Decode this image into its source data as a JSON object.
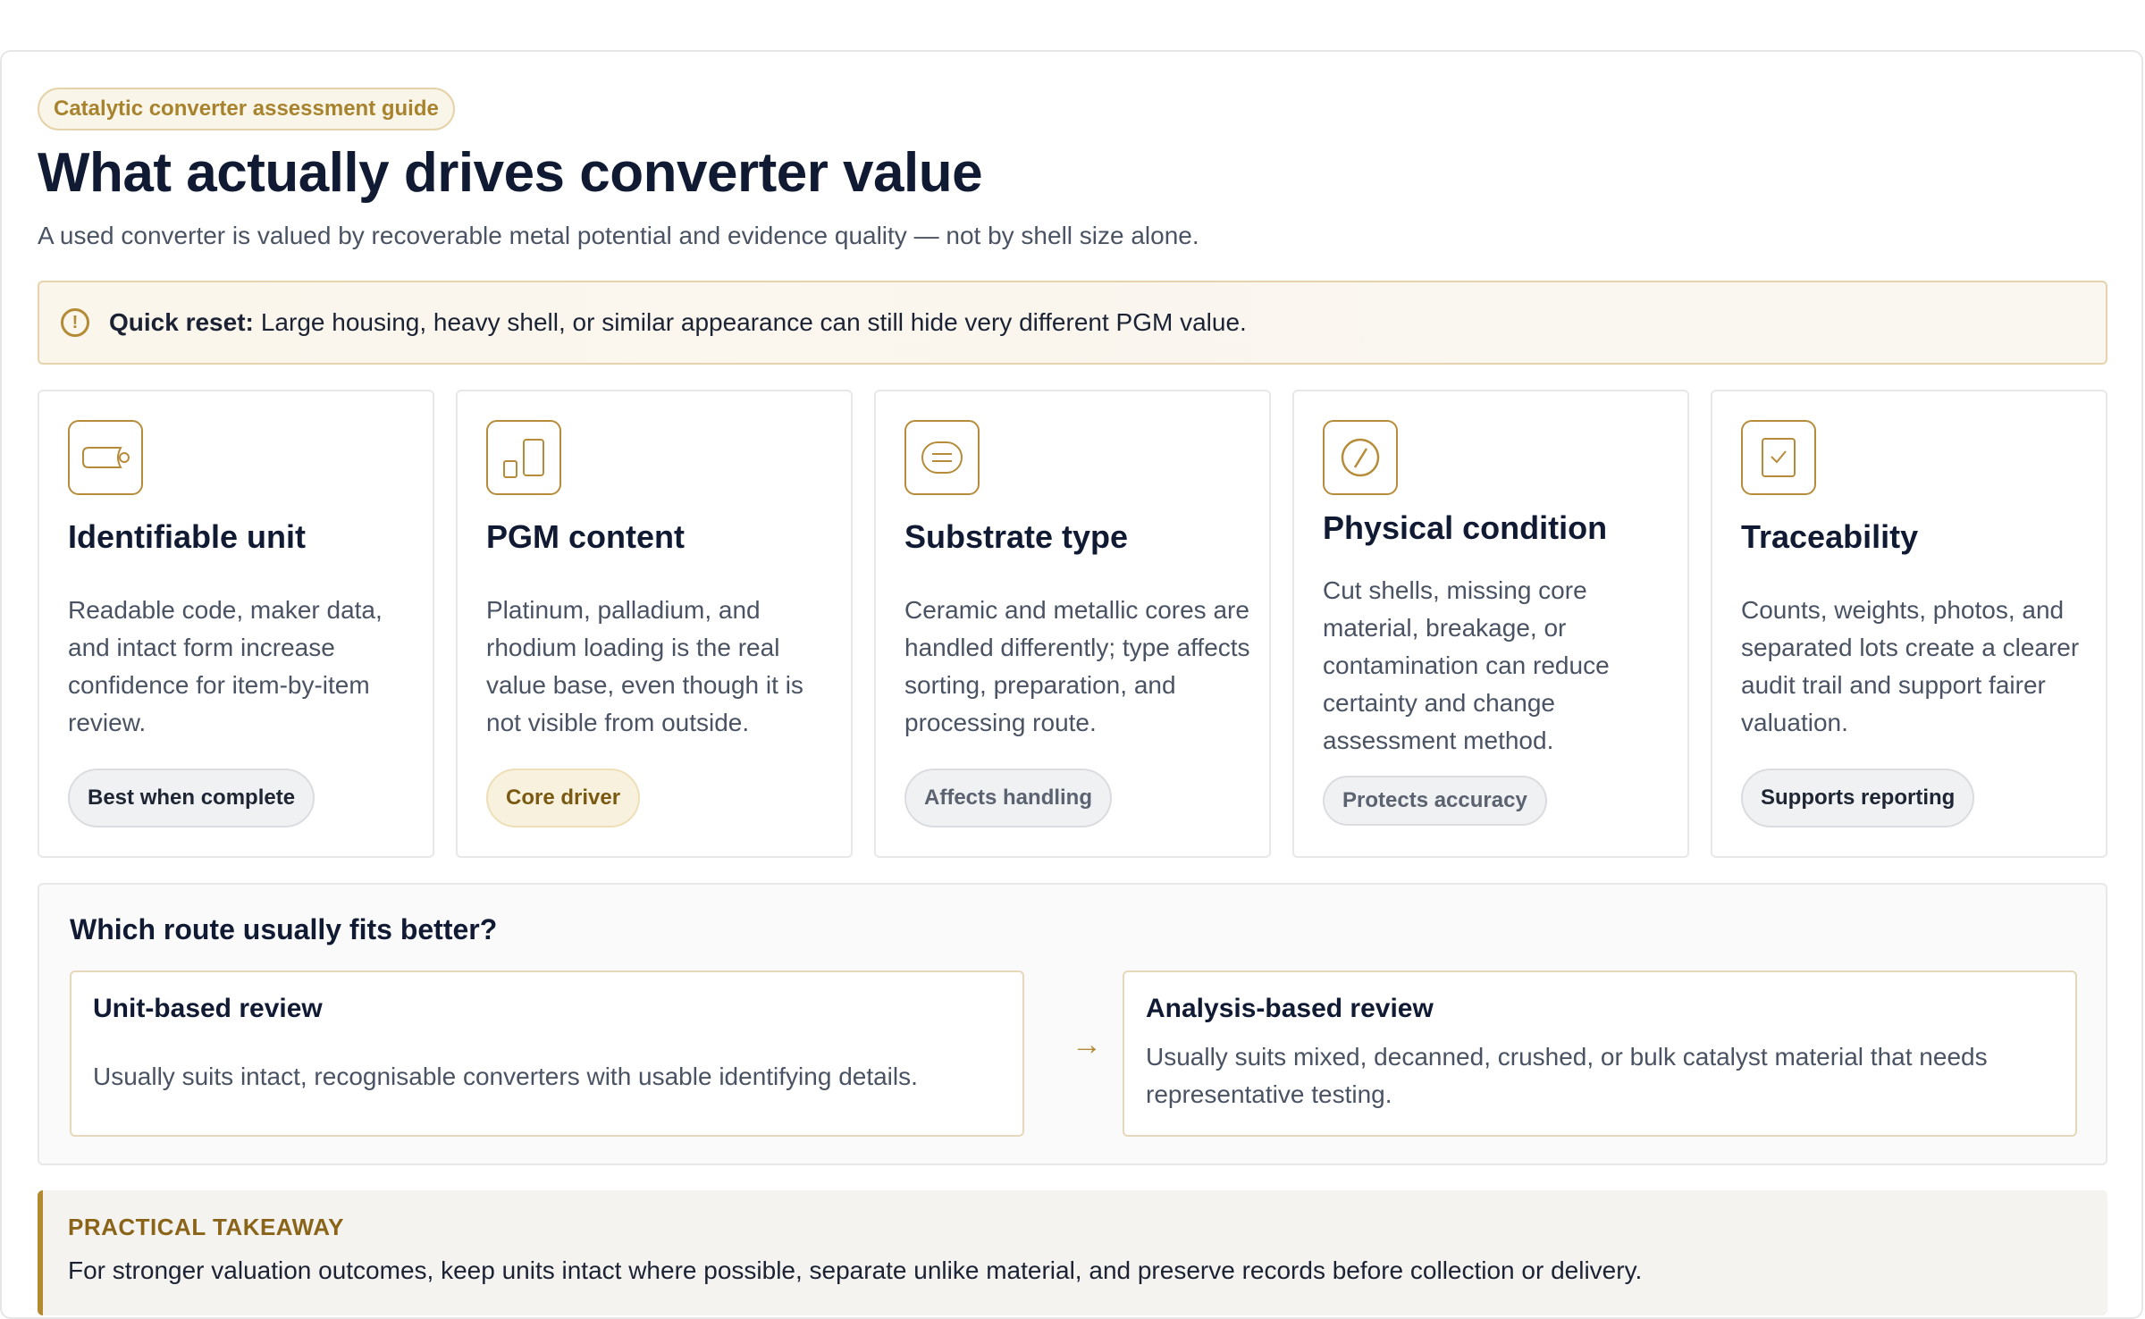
{
  "header": {
    "badge": "Catalytic converter assessment guide",
    "title": "What actually drives converter value",
    "subtitle": "A used converter is valued by recoverable metal potential and evidence quality — not by shell size alone."
  },
  "quick_reset": {
    "label": "Quick reset:",
    "text": "Large housing, heavy shell, or similar appearance can still hide very different PGM value."
  },
  "factors": [
    {
      "icon": "converter-unit-icon",
      "title": "Identifiable unit",
      "body": "Readable code, maker data, and intact form increase confidence for item-by-item review.",
      "tag": "Best when complete"
    },
    {
      "icon": "bar-chart-icon",
      "title": "PGM content",
      "body": "Platinum, palladium, and rhodium loading is the real value base, even though it is not visible from outside.",
      "tag": "Core driver"
    },
    {
      "icon": "substrate-core-icon",
      "title": "Substrate type",
      "body": "Ceramic and metallic cores are handled differently; type affects sorting, preparation, and processing route.",
      "tag": "Affects handling"
    },
    {
      "icon": "slash-circle-icon",
      "title": "Physical condition",
      "body": "Cut shells, missing core material, breakage, or contamination can reduce certainty and change assessment method.",
      "tag": "Protects accuracy"
    },
    {
      "icon": "checklist-icon",
      "title": "Traceability",
      "body": "Counts, weights, photos, and separated lots create a clearer audit trail and support fairer valuation.",
      "tag": "Supports reporting"
    }
  ],
  "routes": {
    "title": "Which route usually fits better?",
    "unit": {
      "title": "Unit-based review",
      "body": "Usually suits intact, recognisable converters with usable identifying details."
    },
    "arrow": "→",
    "analysis": {
      "title": "Analysis-based review",
      "body": "Usually suits mixed, decanned, crushed, or bulk catalyst material that needs representative testing."
    }
  },
  "takeaway": {
    "label": "PRACTICAL TAKEAWAY",
    "text": "For stronger valuation outcomes, keep units intact where possible, separate unlike material, and preserve records before collection or delivery."
  },
  "colors": {
    "accent_gold": "#b38a35",
    "heading": "#101a33",
    "body_text": "#4a5363"
  }
}
